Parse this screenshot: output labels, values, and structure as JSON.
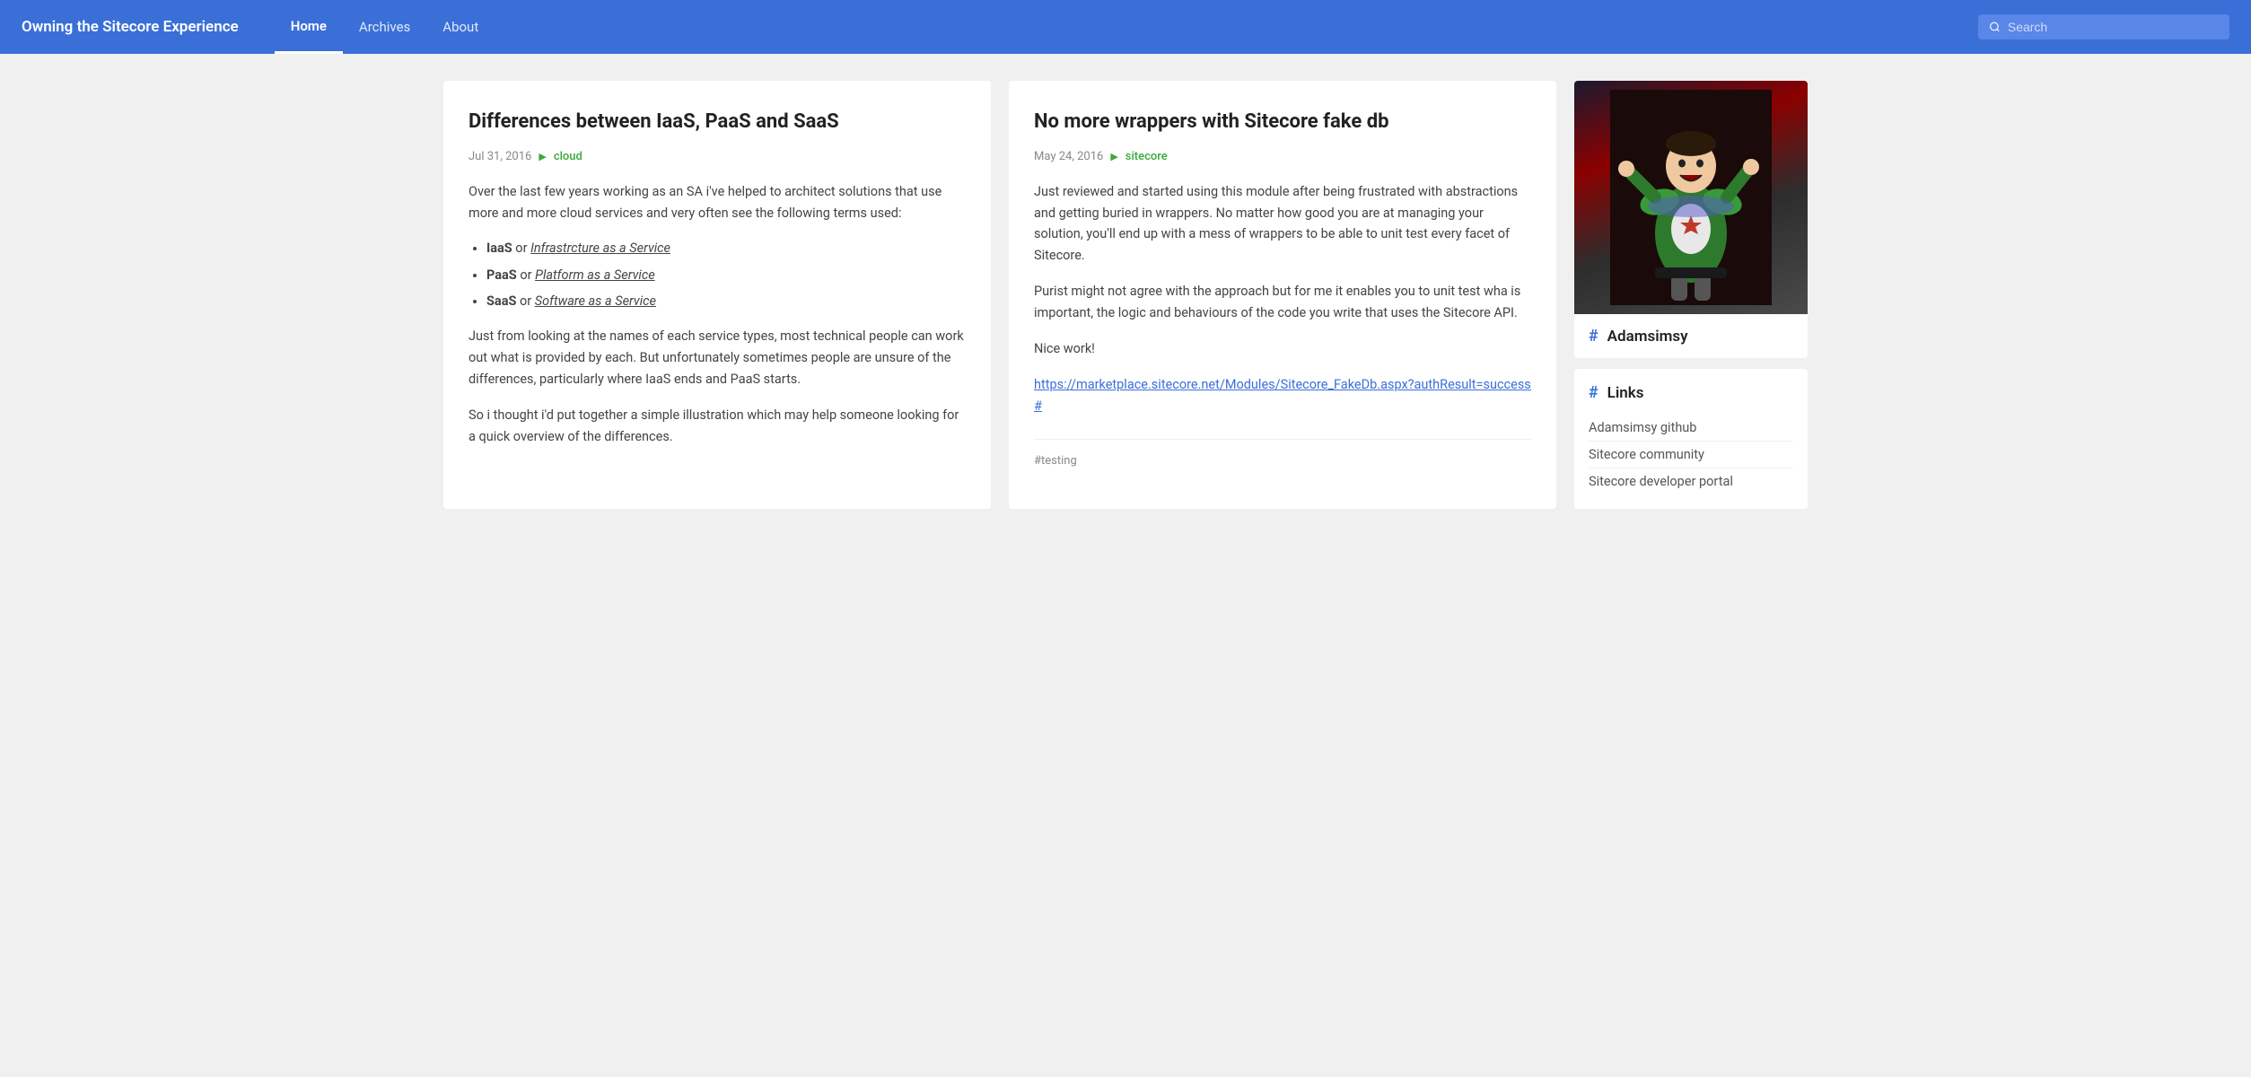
{
  "nav": {
    "brand": "Owning the Sitecore Experience",
    "links": [
      {
        "label": "Home",
        "active": true
      },
      {
        "label": "Archives",
        "active": false
      },
      {
        "label": "About",
        "active": false
      }
    ],
    "search_placeholder": "Search"
  },
  "cards": [
    {
      "title": "Differences between IaaS, PaaS and SaaS",
      "date": "Jul 31, 2016",
      "tag": "cloud",
      "body_paragraphs": [
        "Over the last few years working as an SA i've helped to architect solutions that use more and more cloud services and very often see the following terms used:",
        "",
        "Just from looking at the names of each service types, most technical people can work out what is provided by each. But unfortunately sometimes people are unsure of the differences, particularly where IaaS ends and PaaS starts.",
        "So i thought i'd put together a simple illustration which may help someone looking for a quick overview of the differences."
      ],
      "list_items": [
        {
          "term": "IaaS",
          "rest": " or ",
          "italic": "Infrastrcture as a Service"
        },
        {
          "term": "PaaS",
          "rest": " or ",
          "italic": "Platform as a Service"
        },
        {
          "term": "SaaS",
          "rest": " or ",
          "italic": "Software as a Service"
        }
      ],
      "footer_tag": null,
      "link": null,
      "extra_paragraphs": []
    },
    {
      "title": "No more wrappers with Sitecore fake db",
      "date": "May 24, 2016",
      "tag": "sitecore",
      "body_paragraphs": [
        "Just reviewed and started using this module after being frustrated with abstractions and getting buried in wrappers. No matter how good you are at managing your solution, you'll end up with a mess of wrappers to be able to unit test every facet of Sitecore.",
        "Purist might not agree with the approach but for me it enables you to unit test wha is important, the logic and behaviours of the code you write that uses the Sitecore API.",
        "Nice work!"
      ],
      "link": "https://marketplace.sitecore.net/Modules/Sitecore_FakeDb.aspx?authResult=success#",
      "footer_tag": "#testing",
      "list_items": [],
      "extra_paragraphs": []
    }
  ],
  "sidebar": {
    "username": "Adamsimsy",
    "hash_symbol": "#",
    "links_title": "Links",
    "links": [
      {
        "label": "Adamsimsy github"
      },
      {
        "label": "Sitecore community"
      },
      {
        "label": "Sitecore developer portal"
      }
    ]
  }
}
